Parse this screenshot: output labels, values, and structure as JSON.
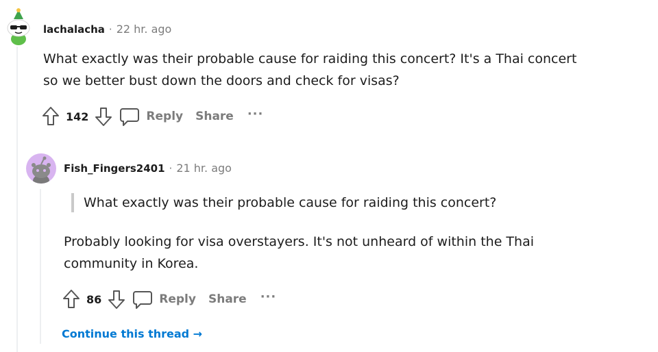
{
  "comment1": {
    "username": "lachalacha",
    "separator": "·",
    "time": "22 hr. ago",
    "body_lines": [
      "What exactly was their probable cause for raiding this concert? It's a Thai concert",
      "so we better bust down the doors and check for visas?"
    ],
    "votes": "142",
    "reply_label": "Reply",
    "share_label": "Share",
    "more_label": "···"
  },
  "comment2": {
    "username": "Fish_Fingers2401",
    "separator": "·",
    "time": "21 hr. ago",
    "quote": "What exactly was their probable cause for raiding this concert?",
    "body_lines": [
      "Probably looking for visa overstayers. It's not unheard of within the Thai",
      "community in Korea."
    ],
    "votes": "86",
    "reply_label": "Reply",
    "share_label": "Share",
    "more_label": "···",
    "continue_label": "Continue this thread →"
  },
  "colors": {
    "link_blue": "#0079d3",
    "meta_gray": "#7c7c7c",
    "avatar2_bg": "#d8b4f0"
  }
}
